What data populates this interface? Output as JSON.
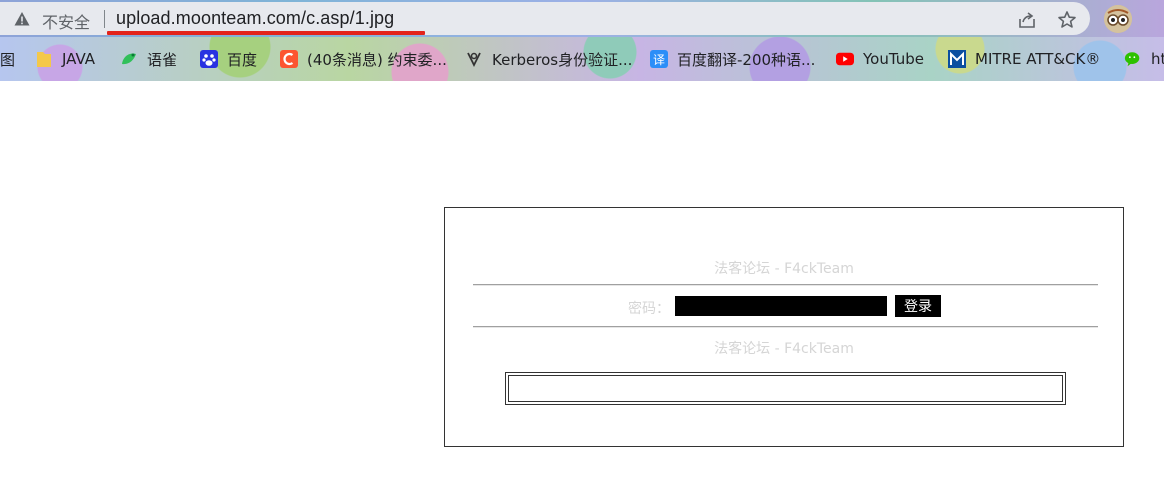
{
  "address_bar": {
    "security_label": "不安全",
    "url": "upload.moonteam.com/c.asp/1.jpg"
  },
  "bookmarks": [
    {
      "label": "图",
      "icon": "image-icon"
    },
    {
      "label": "JAVA",
      "icon": "folder-icon"
    },
    {
      "label": "语雀",
      "icon": "yuque-icon"
    },
    {
      "label": "百度",
      "icon": "baidu-icon"
    },
    {
      "label": "(40条消息) 约束委...",
      "icon": "csdn-icon"
    },
    {
      "label": "Kerberos身份验证...",
      "icon": "kerberos-icon"
    },
    {
      "label": "百度翻译-200种语...",
      "icon": "translate-icon"
    },
    {
      "label": "YouTube",
      "icon": "youtube-icon"
    },
    {
      "label": "MITRE ATT&CK®",
      "icon": "mitre-icon"
    },
    {
      "label": "ht",
      "icon": "wechat-icon"
    }
  ],
  "page": {
    "title_top": "法客论坛 - F4ckTeam",
    "password_label": "密码：",
    "login_button": "登录",
    "title_bottom": "法客论坛 - F4ckTeam"
  },
  "colors": {
    "url_underline": "#e3231b",
    "faint_text": "#d5d5d5",
    "input_bg": "#000000"
  }
}
